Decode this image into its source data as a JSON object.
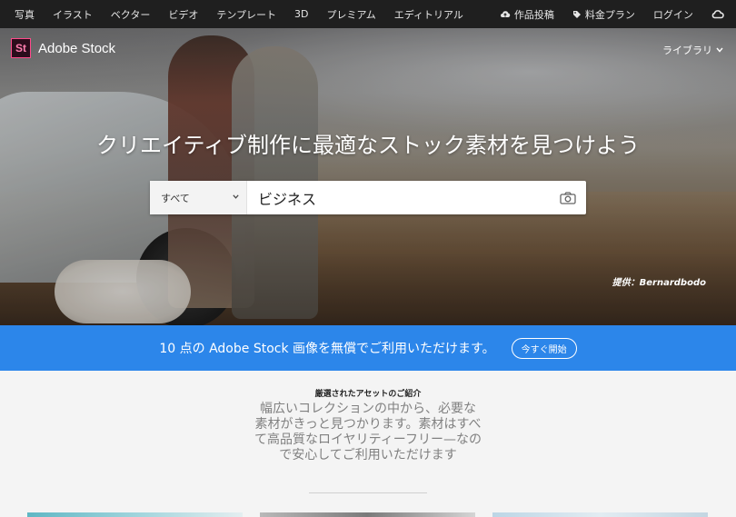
{
  "topnav": {
    "items": [
      "写真",
      "イラスト",
      "ベクター",
      "ビデオ",
      "テンプレート",
      "3D",
      "プレミアム",
      "エディトリアル"
    ],
    "upload_label": "作品投稿",
    "pricing_label": "料金プラン",
    "login_label": "ログイン"
  },
  "brand": {
    "logo_text": "St",
    "name": "Adobe Stock"
  },
  "library_label": "ライブラリ",
  "hero": {
    "headline": "クリエイティブ制作に最適なストック素材を見つけよう",
    "credit": "提供：Bernardbodo"
  },
  "search": {
    "category_value": "すべて",
    "query_value": "ビジネス"
  },
  "banner": {
    "message": "10 点の Adobe Stock 画像を無償でご利用いただけます。",
    "cta_label": "今すぐ開始",
    "color": "#2c86ea"
  },
  "featured": {
    "title": "厳選されたアセットのご紹介",
    "description": "幅広いコレクションの中から、必要な素材がきっと見つかります。素材はすべて高品質なロイヤリティーフリー—なので安心してご利用いただけます"
  },
  "colors": {
    "nav_bg": "#1f1f1f",
    "accent": "#2c86ea",
    "logo_border": "#ff4a8b"
  }
}
